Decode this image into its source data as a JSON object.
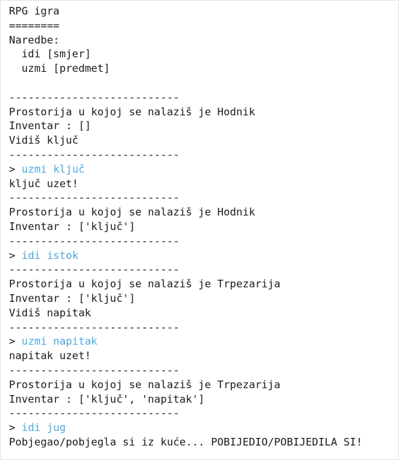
{
  "colors": {
    "text": "#1a1a1a",
    "command": "#4fa8e0",
    "background": "#ffffff"
  },
  "console": {
    "lines": [
      {
        "type": "title",
        "text": "RPG igra"
      },
      {
        "type": "text",
        "text": "========"
      },
      {
        "type": "text",
        "text": "Naredbe:"
      },
      {
        "type": "text",
        "text": "  idi [smjer]"
      },
      {
        "type": "text",
        "text": "  uzmi [predmet]"
      },
      {
        "type": "blank",
        "text": ""
      },
      {
        "type": "separator",
        "text": "---------------------------"
      },
      {
        "type": "room",
        "text": "Prostorija u kojoj se nalaziš je Hodnik"
      },
      {
        "type": "inventory",
        "text": "Inventar : []"
      },
      {
        "type": "item",
        "text": "Vidiš ključ"
      },
      {
        "type": "separator",
        "text": "---------------------------"
      },
      {
        "type": "command",
        "prompt": "> ",
        "text": "uzmi ključ"
      },
      {
        "type": "response",
        "text": "ključ uzet!"
      },
      {
        "type": "separator",
        "text": "---------------------------"
      },
      {
        "type": "room",
        "text": "Prostorija u kojoj se nalaziš je Hodnik"
      },
      {
        "type": "inventory",
        "text": "Inventar : ['ključ']"
      },
      {
        "type": "separator",
        "text": "---------------------------"
      },
      {
        "type": "command",
        "prompt": "> ",
        "text": "idi istok"
      },
      {
        "type": "separator",
        "text": "---------------------------"
      },
      {
        "type": "room",
        "text": "Prostorija u kojoj se nalaziš je Trpezarija"
      },
      {
        "type": "inventory",
        "text": "Inventar : ['ključ']"
      },
      {
        "type": "item",
        "text": "Vidiš napitak"
      },
      {
        "type": "separator",
        "text": "---------------------------"
      },
      {
        "type": "command",
        "prompt": "> ",
        "text": "uzmi napitak"
      },
      {
        "type": "response",
        "text": "napitak uzet!"
      },
      {
        "type": "separator",
        "text": "---------------------------"
      },
      {
        "type": "room",
        "text": "Prostorija u kojoj se nalaziš je Trpezarija"
      },
      {
        "type": "inventory",
        "text": "Inventar : ['ključ', 'napitak']"
      },
      {
        "type": "separator",
        "text": "---------------------------"
      },
      {
        "type": "command",
        "prompt": "> ",
        "text": "idi jug"
      },
      {
        "type": "response",
        "text": "Pobjegao/pobjegla si iz kuće... POBIJEDIO/POBIJEDILA SI!"
      }
    ]
  }
}
